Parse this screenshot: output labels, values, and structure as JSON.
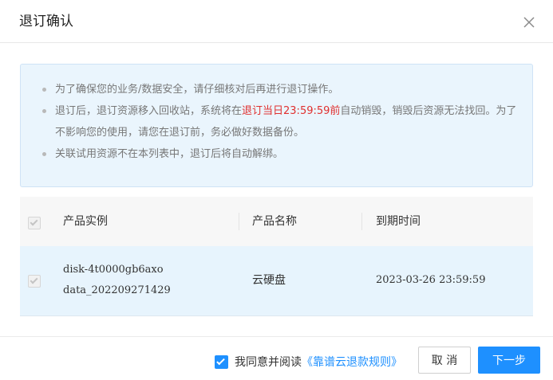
{
  "dialog": {
    "title": "退订确认",
    "close_icon": "close-icon"
  },
  "notice": {
    "items": [
      {
        "text": "为了确保您的业务/数据安全，请仔细核对后再进行退订操作。"
      },
      {
        "text_before": "退订后，退订资源移入回收站，系统将在",
        "highlight": "退订当日23:59:59前",
        "text_after": "自动销毁，销毁后资源无法找回。为了不影响您的使用，请您在退订前，务必做好数据备份。"
      },
      {
        "text": "关联试用资源不在本列表中，退订后将自动解绑。"
      }
    ],
    "highlight_color": "#e0302f"
  },
  "table": {
    "columns": [
      "产品实例",
      "产品名称",
      "到期时间"
    ],
    "header_checkbox": {
      "checked": true,
      "disabled": true
    },
    "rows": [
      {
        "checked": true,
        "disabled": true,
        "instance_id": "disk-4t0000gb6axo",
        "instance_name": "data_202209271429",
        "product_name": "云硬盘",
        "expire_time": "2023-03-26 23:59:59"
      }
    ]
  },
  "footer": {
    "agree_checked": true,
    "agree_text": "我同意并阅读",
    "agree_link": "《靠谱云退款规则》",
    "cancel_label": "取 消",
    "next_label": "下一步"
  },
  "colors": {
    "accent": "#1e90ff",
    "notice_bg": "#eaf5fd",
    "row_selected_bg": "#e7f4fd"
  }
}
